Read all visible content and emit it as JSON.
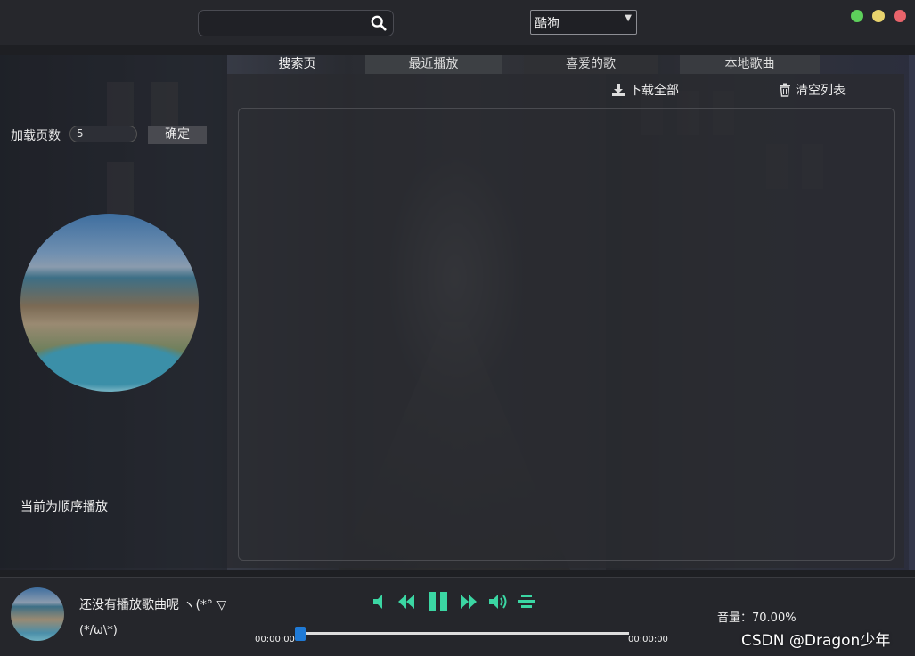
{
  "search": {
    "value": "",
    "placeholder": ""
  },
  "source": {
    "selected": "酷狗"
  },
  "window_controls": {
    "minimize_color": "#5dd05b",
    "maximize_color": "#e8d36d",
    "close_color": "#e9646b"
  },
  "left": {
    "pages_label": "加载页数",
    "pages_value": "5",
    "confirm_label": "确定",
    "mode_text": "当前为顺序播放"
  },
  "tabs": [
    {
      "label": "搜索页"
    },
    {
      "label": "最近播放"
    },
    {
      "label": "喜爱的歌"
    },
    {
      "label": "本地歌曲"
    }
  ],
  "actions": {
    "download_all": "下载全部",
    "clear_list": "清空列表"
  },
  "player": {
    "title": "还没有播放歌曲呢 ヽ(*° ▽",
    "subtitle": "(*/ω\\*)",
    "time_current": "00:00:00",
    "time_total": "00:00:00",
    "progress": 0.0,
    "volume": "音量：70.00%",
    "accent": "#3bd6a3"
  },
  "watermark": "CSDN @Dragon少年"
}
